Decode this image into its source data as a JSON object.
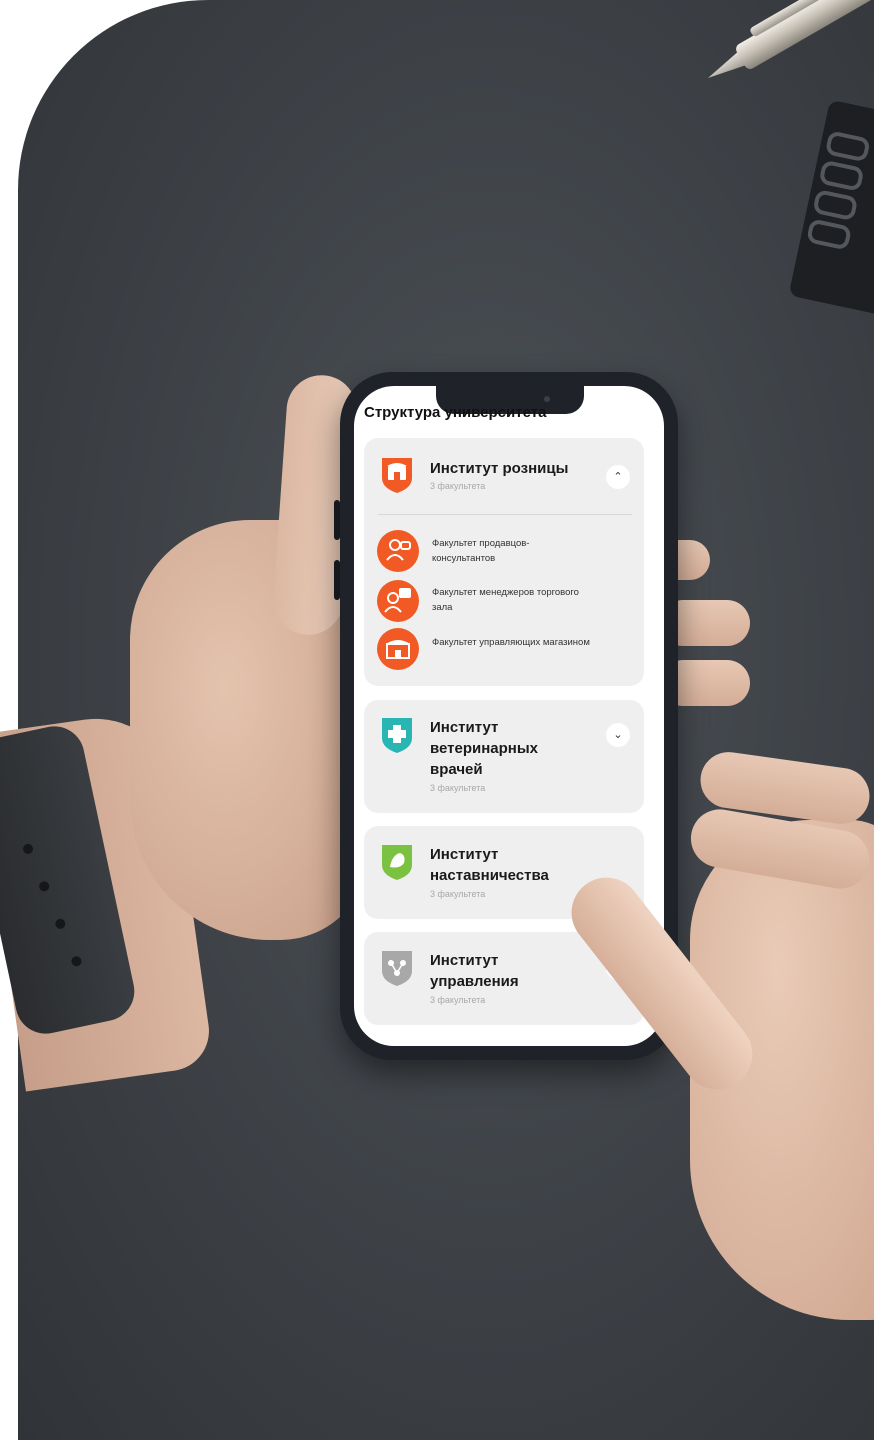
{
  "screen": {
    "title": "Структура университета"
  },
  "institutes": [
    {
      "name": "Институт розницы",
      "subtitle": "3 факультета",
      "expanded": true,
      "icon": "shop-shield-icon",
      "color": "#f15a24",
      "faculties": [
        {
          "label": "Факультет продавцов-консультантов",
          "icon": "consultant-icon"
        },
        {
          "label": "Факультет менеджеров торгового зала",
          "icon": "manager-icon"
        },
        {
          "label": "Факультет управляющих магазином",
          "icon": "store-icon"
        }
      ]
    },
    {
      "name": "Институт ветеринарных врачей",
      "subtitle": "3 факультета",
      "expanded": false,
      "icon": "vet-cross-shield-icon",
      "color": "#2ab5b5"
    },
    {
      "name": "Институт наставничества",
      "subtitle": "3 факультета",
      "expanded": false,
      "icon": "mentor-bird-shield-icon",
      "color": "#7cc242"
    },
    {
      "name": "Институт управления",
      "subtitle": "3 факультета",
      "expanded": false,
      "icon": "management-shield-icon",
      "color": "#a8a8a8"
    }
  ]
}
